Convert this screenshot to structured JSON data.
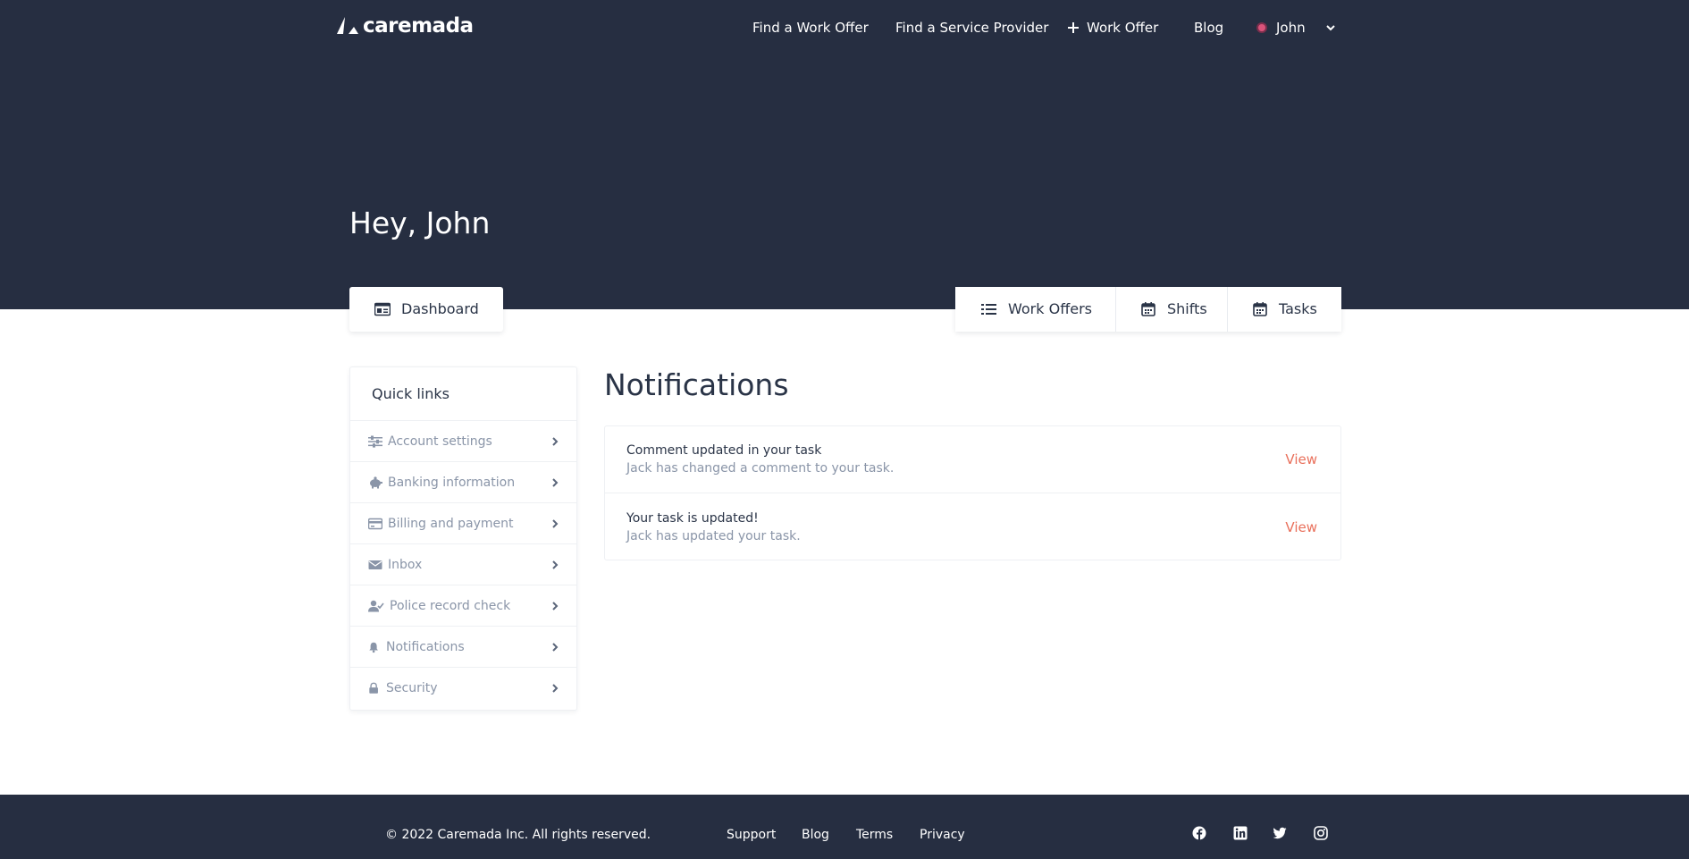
{
  "header": {
    "logo_text": "caremada",
    "nav": {
      "find_work_offer": "Find a Work Offer",
      "find_service_provider": "Find a Service Provider",
      "add_work_offer": "Work Offer",
      "blog": "Blog",
      "user_name": "John"
    }
  },
  "hero": {
    "greeting": "Hey, John"
  },
  "tabs": {
    "dashboard": "Dashboard",
    "work_offers": "Work Offers",
    "shifts": "Shifts",
    "tasks": "Tasks"
  },
  "sidebar": {
    "title": "Quick links",
    "items": [
      {
        "label": "Account settings",
        "icon": "sliders-icon"
      },
      {
        "label": "Banking information",
        "icon": "piggy-bank-icon"
      },
      {
        "label": "Billing and payment",
        "icon": "credit-card-icon"
      },
      {
        "label": "Inbox",
        "icon": "envelope-icon"
      },
      {
        "label": "Police record check",
        "icon": "user-check-icon"
      },
      {
        "label": "Notifications",
        "icon": "bell-icon"
      },
      {
        "label": "Security",
        "icon": "lock-icon"
      }
    ]
  },
  "notifications": {
    "title": "Notifications",
    "items": [
      {
        "heading": "Comment updated in your task",
        "detail": "Jack has changed a comment to your task.",
        "action": "View"
      },
      {
        "heading": "Your task is updated!",
        "detail": "Jack has updated your task.",
        "action": "View"
      }
    ]
  },
  "footer": {
    "copyright": "© 2022 Caremada Inc. All rights reserved.",
    "links": {
      "support": "Support",
      "blog": "Blog",
      "terms": "Terms",
      "privacy": "Privacy"
    },
    "social": [
      "facebook-icon",
      "linkedin-icon",
      "twitter-icon",
      "instagram-icon"
    ]
  },
  "colors": {
    "header_bg": "#262e41",
    "accent": "#e9705b",
    "text_primary": "#2a3447",
    "text_muted": "#8a95a8"
  }
}
